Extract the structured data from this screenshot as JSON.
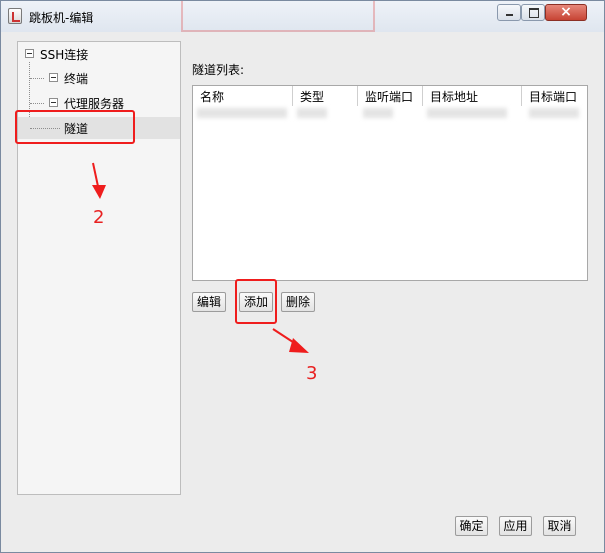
{
  "window": {
    "title": "跳板机-编辑"
  },
  "tree": {
    "root": "SSH连接",
    "items": [
      {
        "label": "终端"
      },
      {
        "label": "代理服务器"
      },
      {
        "label": "隧道"
      }
    ]
  },
  "tunnels": {
    "section_label": "隧道列表:",
    "columns": [
      "名称",
      "类型",
      "监听端口",
      "目标地址",
      "目标端口"
    ],
    "buttons": {
      "edit": "编辑",
      "add": "添加",
      "delete": "删除"
    }
  },
  "footer": {
    "ok": "确定",
    "apply": "应用",
    "cancel": "取消"
  },
  "annotations": {
    "step2": "2",
    "step3": "3"
  },
  "colors": {
    "annotation": "#ef1d1d",
    "selection": "#e2e2e2"
  }
}
